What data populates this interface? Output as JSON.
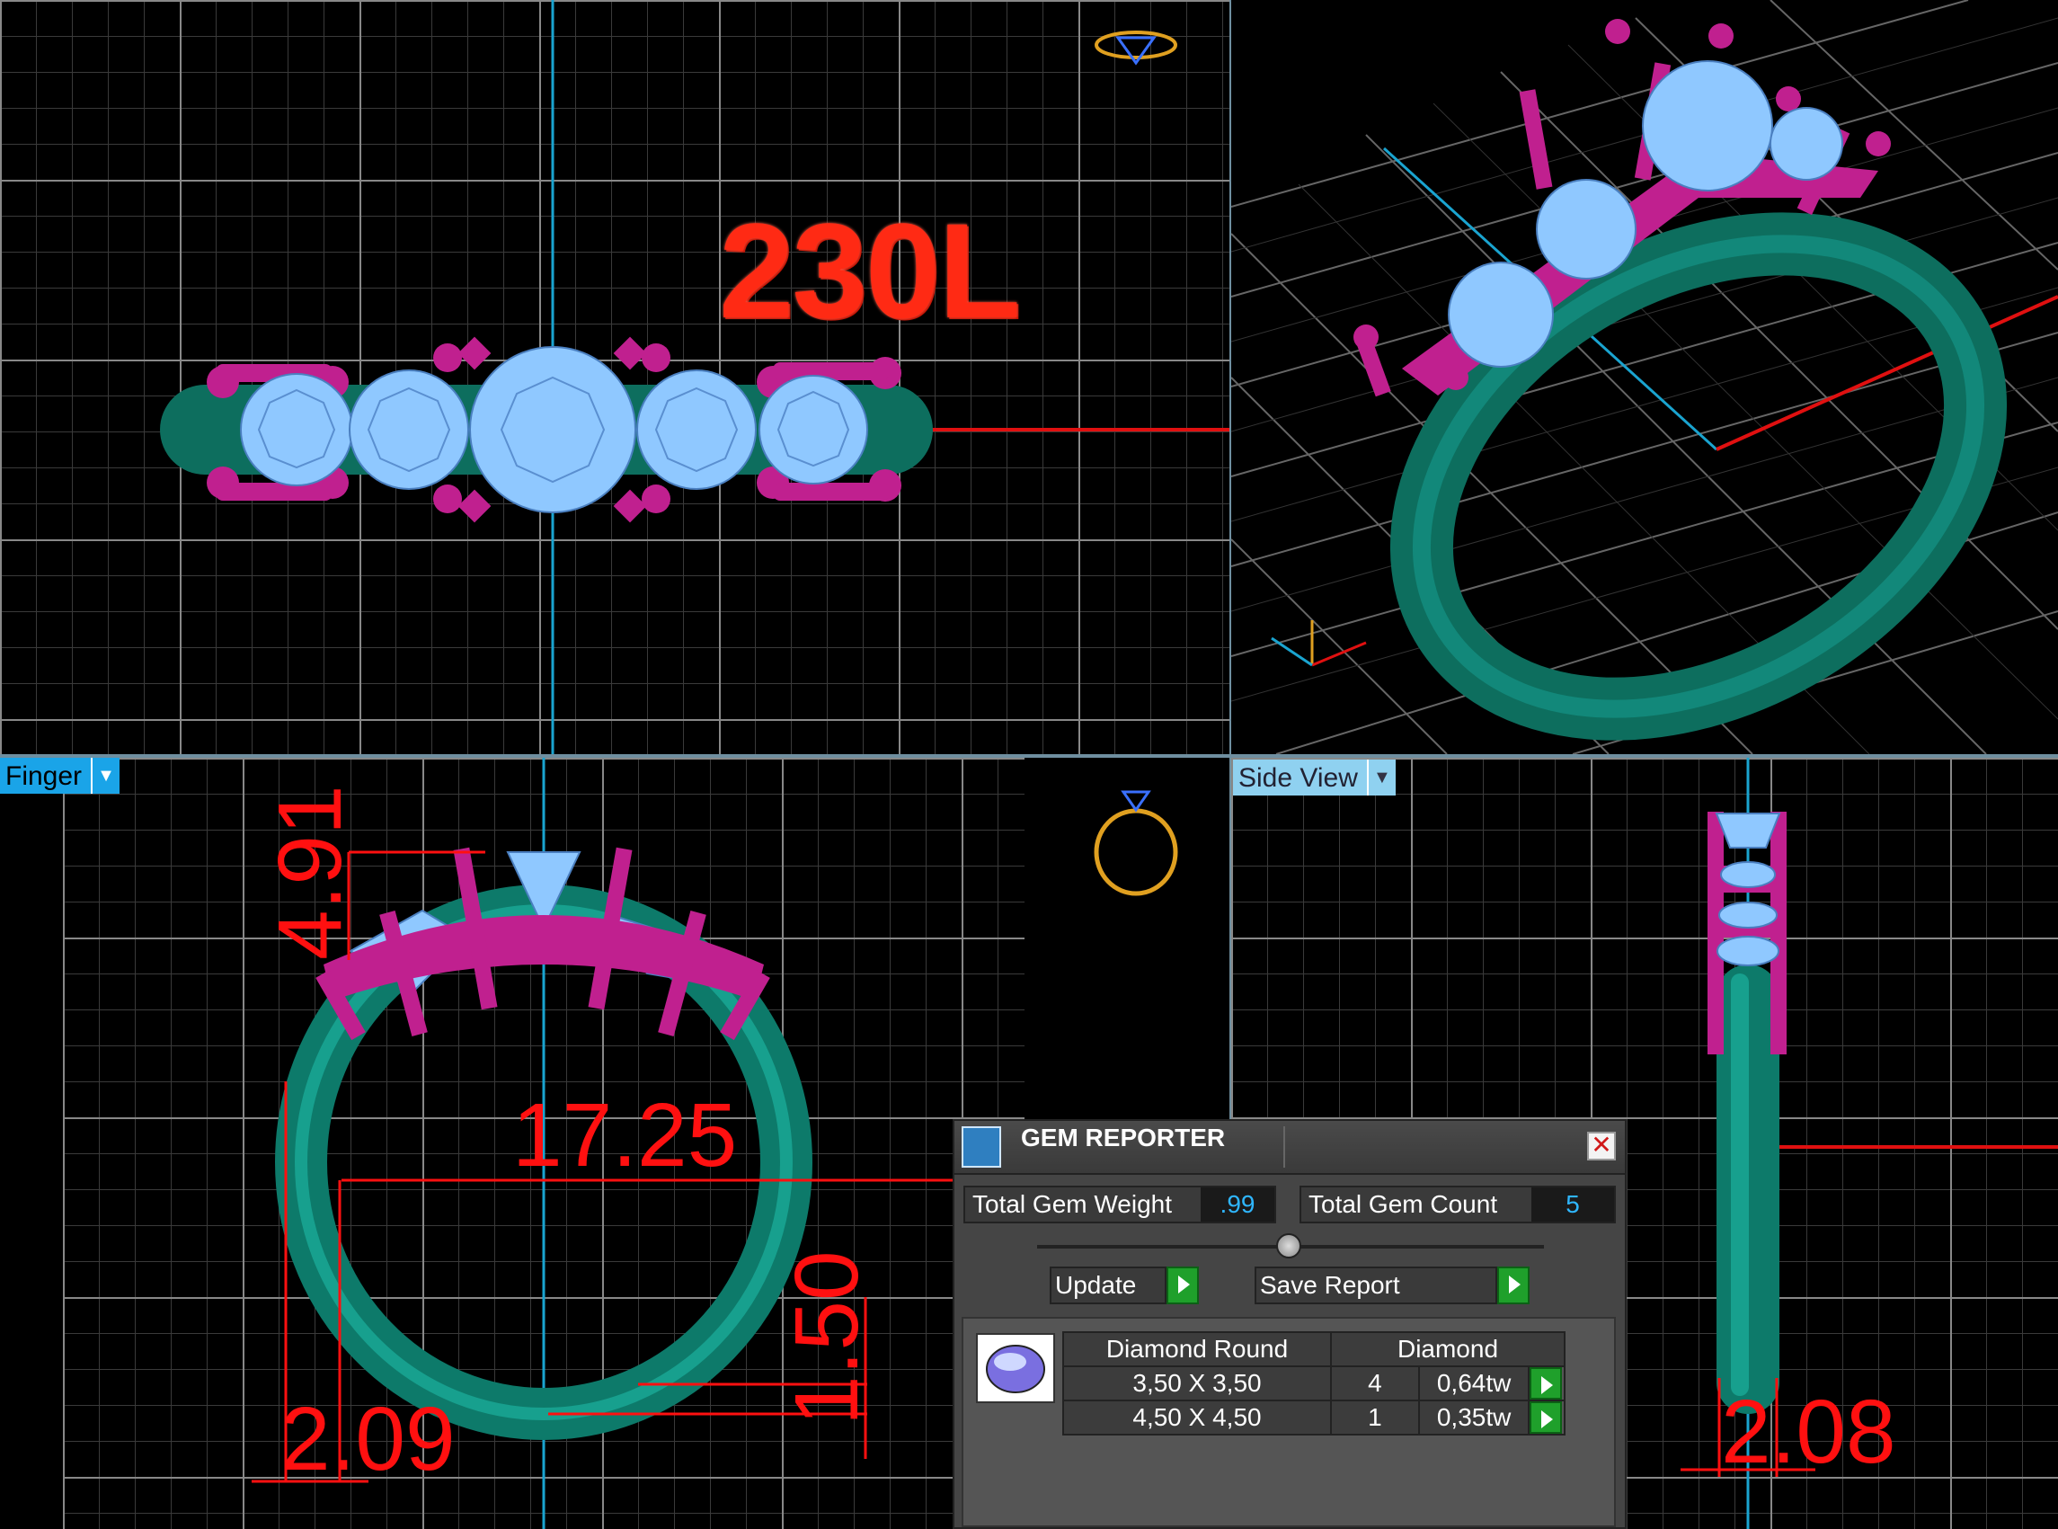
{
  "top_view": {
    "model_label": "230L"
  },
  "front_view": {
    "view_dropdown": "Finger",
    "dimensions": {
      "height": "4.91",
      "inner_diameter": "17.25",
      "band_thickness": "1.50",
      "band_width": "2.09"
    }
  },
  "side_view": {
    "view_dropdown": "Side View",
    "dimensions": {
      "band_width": "2.08"
    }
  },
  "gem_reporter": {
    "title": "GEM REPORTER",
    "total_weight_label": "Total Gem Weight",
    "total_weight_value": ".99",
    "total_count_label": "Total Gem Count",
    "total_count_value": "5",
    "update_label": "Update",
    "save_report_label": "Save Report",
    "gem_shape": "Diamond Round",
    "gem_material": "Diamond",
    "rows": [
      {
        "size": "3,50 X 3,50",
        "count": "4",
        "weight": "0,64tw"
      },
      {
        "size": "4,50 X 4,50",
        "count": "1",
        "weight": "0,35tw"
      }
    ]
  },
  "colors": {
    "metal": "#c0208f",
    "band": "#0d6e5e",
    "gem": "#8fc8ff",
    "axis_x": "#e01010",
    "axis_y": "#1aa4d0",
    "dimension": "#ff1010"
  }
}
